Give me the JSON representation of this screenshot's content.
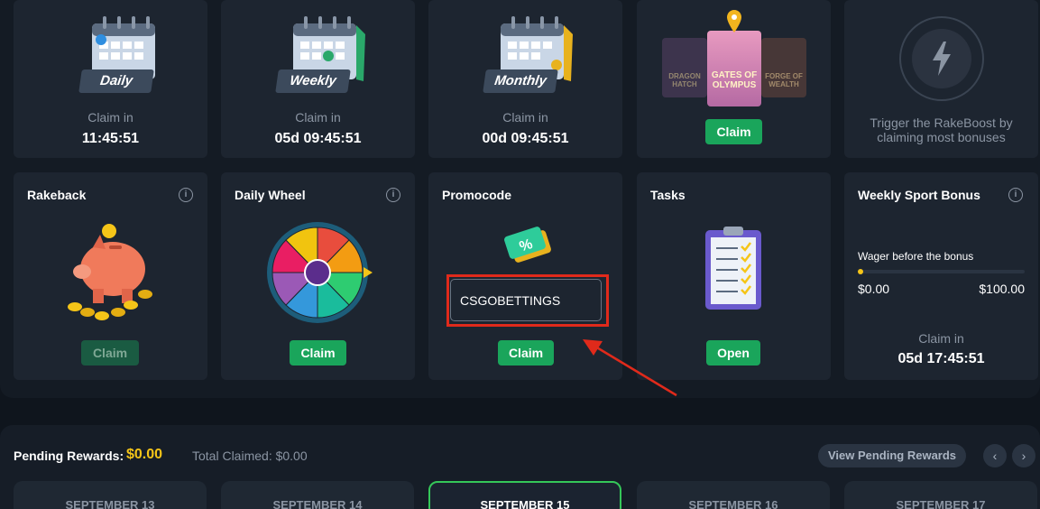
{
  "row1": {
    "daily": {
      "label": "Daily",
      "claim_in": "Claim in",
      "timer": "11:45:51"
    },
    "weekly": {
      "label": "Weekly",
      "claim_in": "Claim in",
      "timer": "05d 09:45:51"
    },
    "monthly": {
      "label": "Monthly",
      "claim_in": "Claim in",
      "timer": "00d 09:45:51"
    },
    "slots": {
      "games": [
        "DRAGON HATCH",
        "GATES OF OLYMPUS",
        "FORGE OF WEALTH"
      ],
      "button": "Claim"
    },
    "rakeboost": {
      "text": "Trigger the RakeBoost by claiming most bonuses"
    }
  },
  "row2": {
    "rakeback": {
      "title": "Rakeback",
      "button": "Claim"
    },
    "wheel": {
      "title": "Daily Wheel",
      "button": "Claim"
    },
    "promocode": {
      "title": "Promocode",
      "input_value": "CSGOBETTINGS",
      "button": "Claim"
    },
    "tasks": {
      "title": "Tasks",
      "button": "Open"
    },
    "sport": {
      "title": "Weekly Sport Bonus",
      "wager_label": "Wager before the bonus",
      "min": "$0.00",
      "max": "$100.00",
      "progress": 0.0,
      "claim_in": "Claim in",
      "timer": "05d 17:45:51"
    }
  },
  "bottom": {
    "pending_label": "Pending Rewards:",
    "pending_value": "$0.00",
    "total_claimed": "Total Claimed: $0.00",
    "view_button": "View Pending Rewards",
    "dates": [
      "SEPTEMBER 13",
      "SEPTEMBER 14",
      "SEPTEMBER 15",
      "SEPTEMBER 16",
      "SEPTEMBER 17"
    ],
    "active_date_index": 2
  },
  "colors": {
    "accent_green": "#1aa55b",
    "highlight_red": "#e02a1b",
    "gold": "#f5c518"
  }
}
